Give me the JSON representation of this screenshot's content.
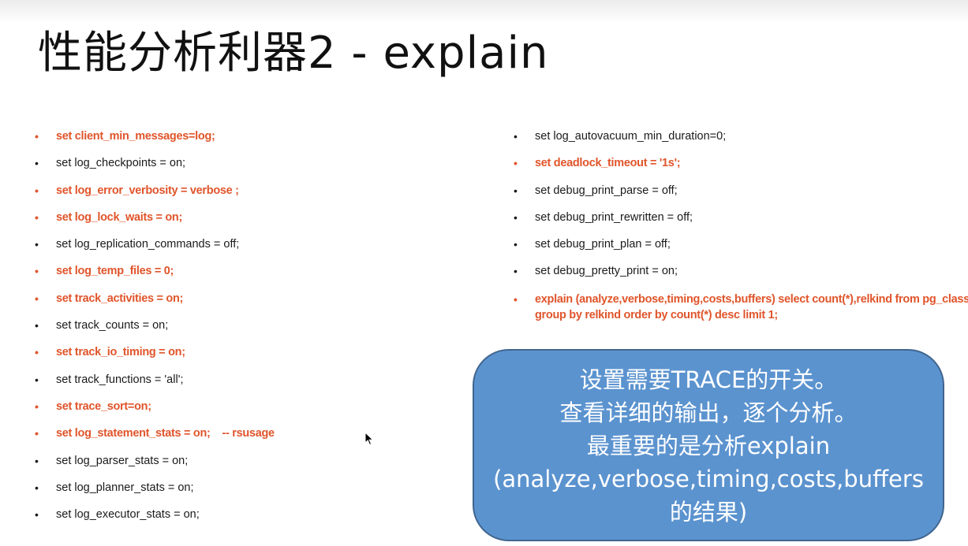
{
  "slide": {
    "title": "性能分析利器2 - explain"
  },
  "left_list": [
    {
      "text": "set client_min_messages=log;",
      "red": true
    },
    {
      "text": "set log_checkpoints = on;",
      "red": false
    },
    {
      "text": "set log_error_verbosity = verbose ;",
      "red": true
    },
    {
      "text": "set log_lock_waits = on;",
      "red": true
    },
    {
      "text": "set log_replication_commands = off;",
      "red": false
    },
    {
      "text": "set log_temp_files = 0;",
      "red": true
    },
    {
      "text": "set track_activities = on;",
      "red": true
    },
    {
      "text": "set track_counts = on;",
      "red": false
    },
    {
      "text": "set track_io_timing = on;",
      "red": true
    },
    {
      "text": "set track_functions = 'all';",
      "red": false
    },
    {
      "text": "set trace_sort=on;",
      "red": true
    },
    {
      "text": "set log_statement_stats = on;    -- rsusage",
      "red": true
    },
    {
      "text": "set log_parser_stats = on;",
      "red": false
    },
    {
      "text": "set log_planner_stats = on;",
      "red": false
    },
    {
      "text": "set log_executor_stats = on;",
      "red": false
    }
  ],
  "right_list": [
    {
      "text": "set log_autovacuum_min_duration=0;",
      "red": false
    },
    {
      "text": "set deadlock_timeout = '1s';",
      "red": true
    },
    {
      "text": "set debug_print_parse = off;",
      "red": false
    },
    {
      "text": "set debug_print_rewritten = off;",
      "red": false
    },
    {
      "text": "set debug_print_plan = off;",
      "red": false
    },
    {
      "text": "set debug_pretty_print = on;",
      "red": false
    },
    {
      "text": "explain (analyze,verbose,timing,costs,buffers) select count(*),relkind from pg_class group by relkind order by count(*) desc limit 1;",
      "red": true
    }
  ],
  "bullet_glyph": "•",
  "callout": {
    "lines": [
      "设置需要TRACE的开关。",
      "查看详细的输出，逐个分析。",
      "最重要的是分析explain",
      "(analyze,verbose,timing,costs,buffers",
      "的结果)"
    ]
  },
  "colors": {
    "highlight_text": "#e0552b",
    "callout_fill": "#5b93cf",
    "callout_border": "#40658f"
  }
}
